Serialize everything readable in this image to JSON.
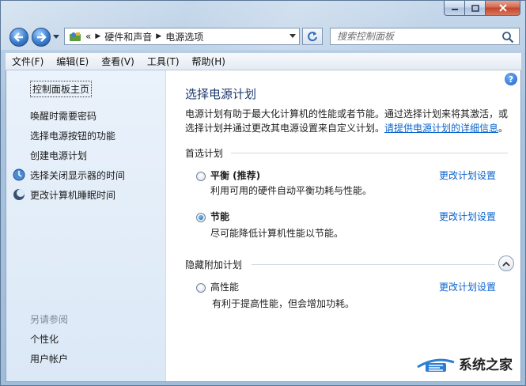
{
  "navigation": {
    "back_icon": "back-arrow-icon",
    "forward_icon": "forward-arrow-icon",
    "overflow_chevron": "«",
    "breadcrumbs": [
      {
        "label": "硬件和声音"
      },
      {
        "label": "电源选项"
      }
    ],
    "search_placeholder": "搜索控制面板"
  },
  "menu": [
    "文件(F)",
    "编辑(E)",
    "查看(V)",
    "工具(T)",
    "帮助(H)"
  ],
  "sidebar": {
    "home": "控制面板主页",
    "tasks": [
      {
        "label": "唤醒时需要密码",
        "icon": ""
      },
      {
        "label": "选择电源按钮的功能",
        "icon": ""
      },
      {
        "label": "创建电源计划",
        "icon": ""
      },
      {
        "label": "选择关闭显示器的时间",
        "icon": "monitor-icon"
      },
      {
        "label": "更改计算机睡眠时间",
        "icon": "moon-icon"
      }
    ],
    "see_also_title": "另请参阅",
    "see_also": [
      "个性化",
      "用户帐户"
    ]
  },
  "main": {
    "title": "选择电源计划",
    "intro": "电源计划有助于最大化计算机的性能或者节能。通过选择计划来将其激活，或选择计划并通过更改其电源设置来自定义计划。",
    "intro_link": "请提供电源计划的详细信息",
    "intro_end": "。",
    "preferred_label": "首选计划",
    "plans": [
      {
        "name": "平衡 (推荐)",
        "desc": "利用可用的硬件自动平衡功耗与性能。",
        "selected": false,
        "link": "更改计划设置"
      },
      {
        "name": "节能",
        "desc": "尽可能降低计算机性能以节能。",
        "selected": true,
        "link": "更改计划设置"
      }
    ],
    "hidden_label": "隐藏附加计划",
    "hidden_plans": [
      {
        "name": "高性能",
        "desc": "有利于提高性能，但会增加功耗。",
        "selected": false,
        "link": "更改计划设置"
      }
    ]
  },
  "watermark": {
    "text": "系统之家"
  },
  "colors": {
    "link": "#0a64cc",
    "title": "#1e3a6e",
    "sidebar_bg": "#e3edf8"
  }
}
